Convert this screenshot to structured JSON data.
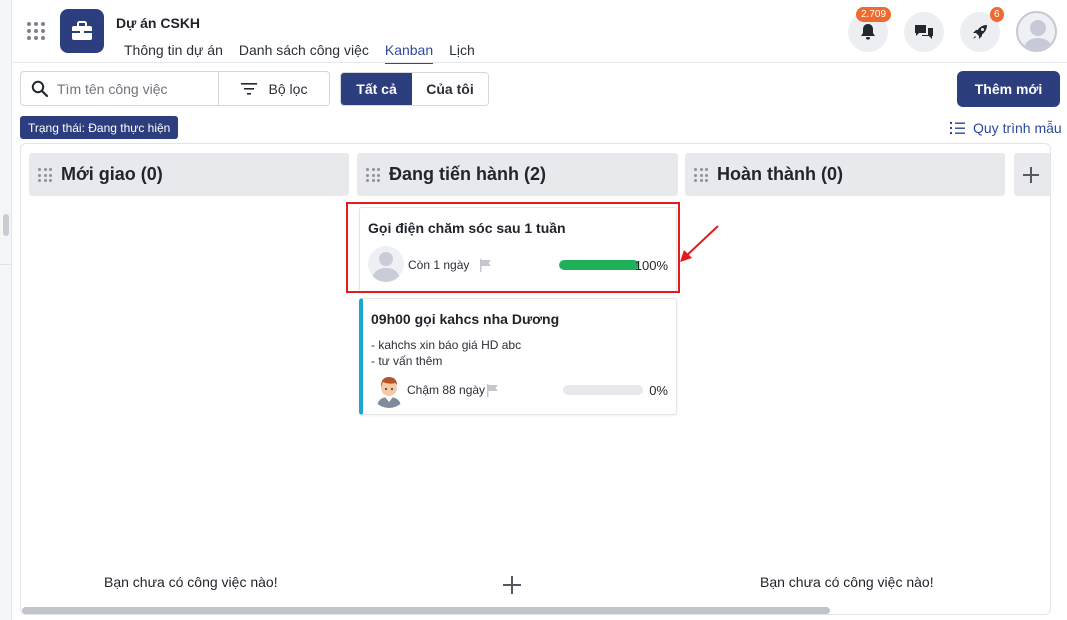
{
  "header": {
    "project_title": "Dự án CSKH",
    "tabs": [
      {
        "label": "Thông tin dự án",
        "active": false
      },
      {
        "label": "Danh sách công việc",
        "active": false
      },
      {
        "label": "Kanban",
        "active": true
      },
      {
        "label": "Lịch",
        "active": false
      }
    ],
    "notification_badge": "2.709",
    "rocket_badge": "6",
    "icons": [
      "apps-grid-icon",
      "briefcase-icon",
      "bell-icon",
      "chat-icon",
      "rocket-icon",
      "user-avatar"
    ]
  },
  "toolbar": {
    "search_placeholder": "Tìm tên công việc",
    "filter_label": "Bộ lọc",
    "segments": [
      {
        "label": "Tất cả",
        "active": true
      },
      {
        "label": "Của tôi",
        "active": false
      }
    ],
    "add_button": "Thêm mới",
    "status_chip": "Trạng thái: Đang thực hiện",
    "workflow_link": "Quy trình mẫu"
  },
  "columns": [
    {
      "title": "Mới giao (0)",
      "empty_message": "Bạn chưa có công việc nào!"
    },
    {
      "title": "Đang tiến hành (2)"
    },
    {
      "title": "Hoàn thành (0)",
      "empty_message": "Bạn chưa có công việc nào!"
    }
  ],
  "cards": [
    {
      "title": "Gọi điện chăm sóc sau 1 tuần",
      "due": "Còn 1 ngày",
      "progress": 100,
      "progress_label": "100%",
      "description": []
    },
    {
      "title": "09h00 gọi kahcs nha Dương",
      "due": "Chậm 88 ngày",
      "progress": 0,
      "progress_label": "0%",
      "description": [
        "- kahchs xin báo giá HD abc",
        "- tư vấn thêm"
      ]
    }
  ],
  "colors": {
    "primary": "#2c3e7e",
    "badge": "#ee6a2e",
    "progress": "#21b05a",
    "highlight": "#e31b1b",
    "card_accent": "#19a7d6"
  }
}
